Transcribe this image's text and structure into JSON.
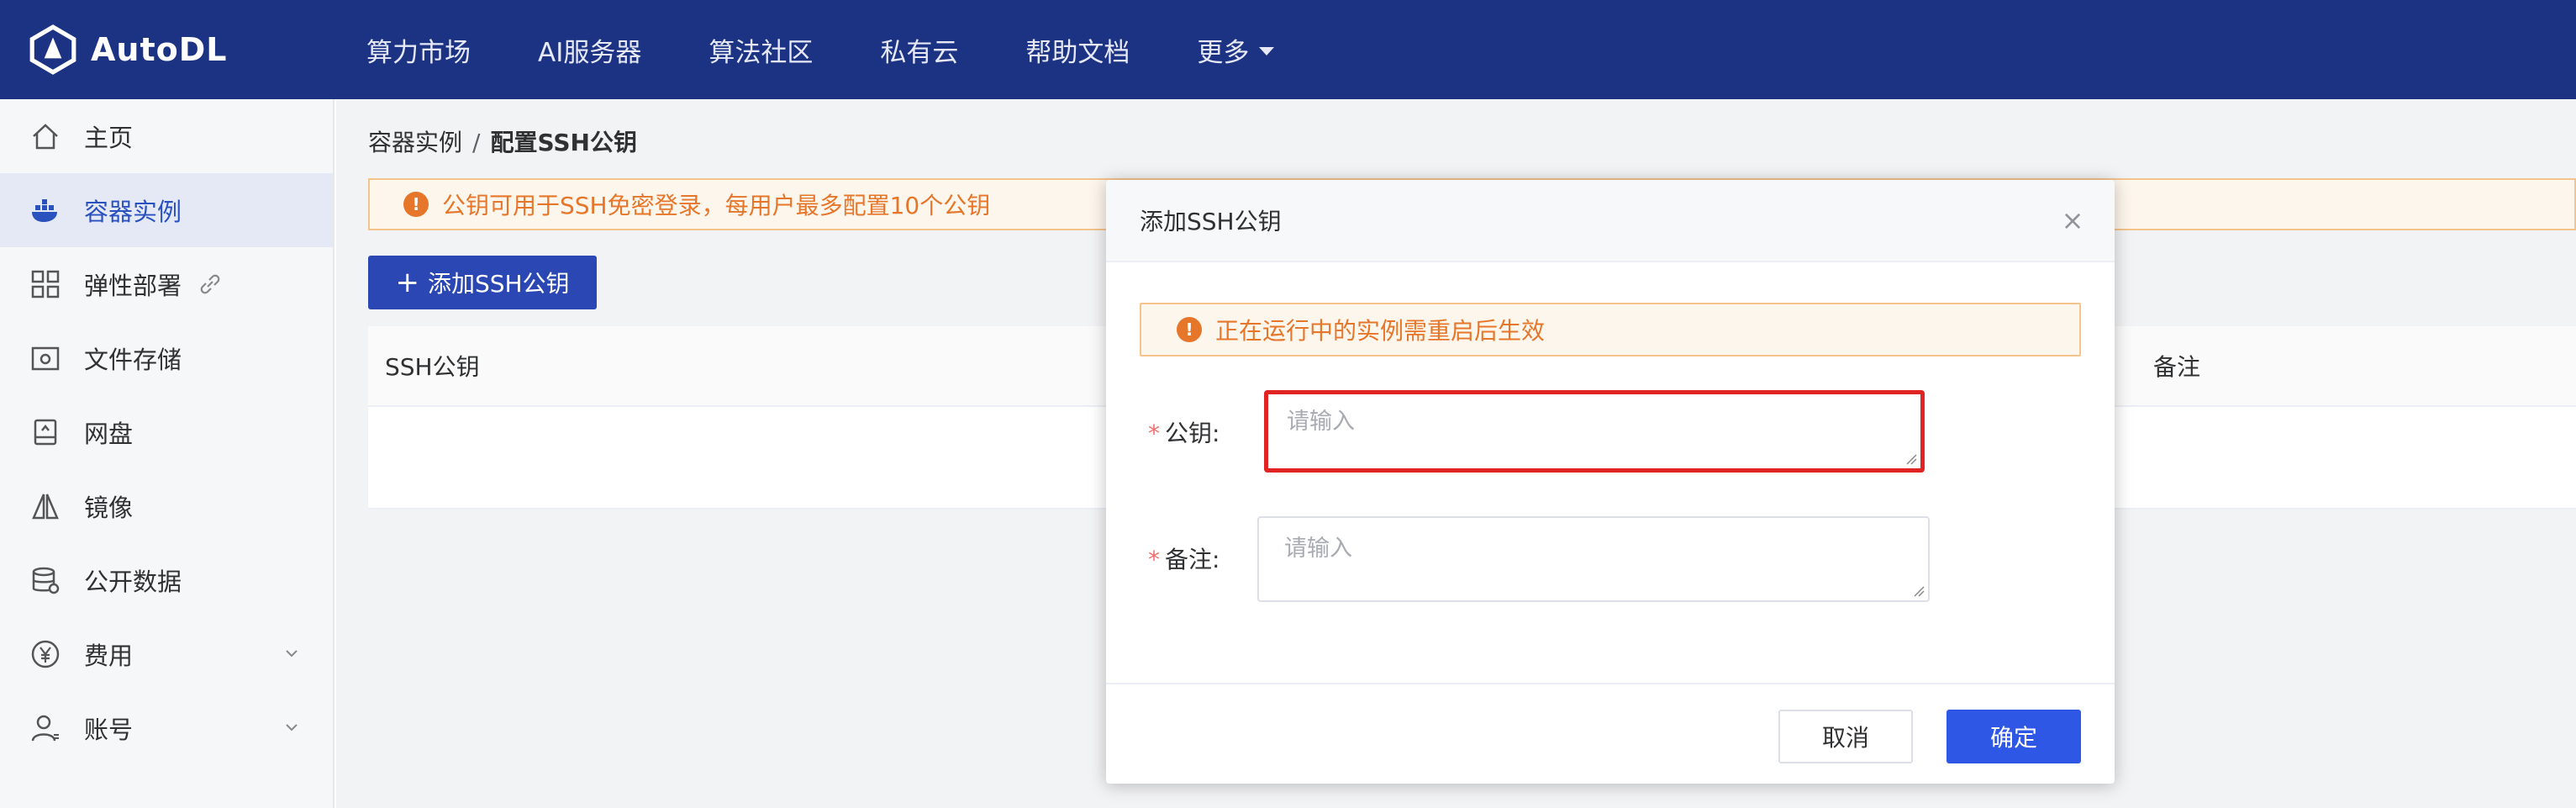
{
  "app": {
    "logo_text": "AutoDL"
  },
  "nav": {
    "items": [
      "算力市场",
      "AI服务器",
      "算法社区",
      "私有云",
      "帮助文档"
    ],
    "more": "更多"
  },
  "sidebar": {
    "items": [
      {
        "label": "主页",
        "icon": "home-icon"
      },
      {
        "label": "容器实例",
        "icon": "container-icon",
        "active": true
      },
      {
        "label": "弹性部署",
        "icon": "grid-icon"
      },
      {
        "label": "文件存储",
        "icon": "folder-icon"
      },
      {
        "label": "网盘",
        "icon": "drive-icon"
      },
      {
        "label": "镜像",
        "icon": "mirror-icon"
      },
      {
        "label": "公开数据",
        "icon": "database-icon"
      },
      {
        "label": "费用",
        "icon": "yen-icon"
      },
      {
        "label": "账号",
        "icon": "user-icon"
      }
    ]
  },
  "breadcrumb": {
    "parent": "容器实例",
    "separator": "/",
    "current": "配置SSH公钥"
  },
  "notice": {
    "text": "公钥可用于SSH免密登录，每用户最多配置10个公钥",
    "icon": "!"
  },
  "toolbar": {
    "add_label": "添加SSH公钥",
    "plus": "+"
  },
  "table": {
    "columns": [
      "SSH公钥",
      "备注"
    ]
  },
  "dialog": {
    "title": "添加SSH公钥",
    "close": "×",
    "alert": "正在运行中的实例需重启后生效",
    "alert_icon": "!",
    "fields": [
      {
        "label": "公钥:",
        "required": "*",
        "placeholder": "请输入",
        "value": ""
      },
      {
        "label": "备注:",
        "required": "*",
        "placeholder": "请输入",
        "value": ""
      }
    ],
    "cancel_label": "取消",
    "confirm_label": "确定"
  },
  "colors": {
    "topbar": "#1c3384",
    "accent": "#2f57e6",
    "warning": "#e6762a",
    "highlight": "#e02424"
  }
}
